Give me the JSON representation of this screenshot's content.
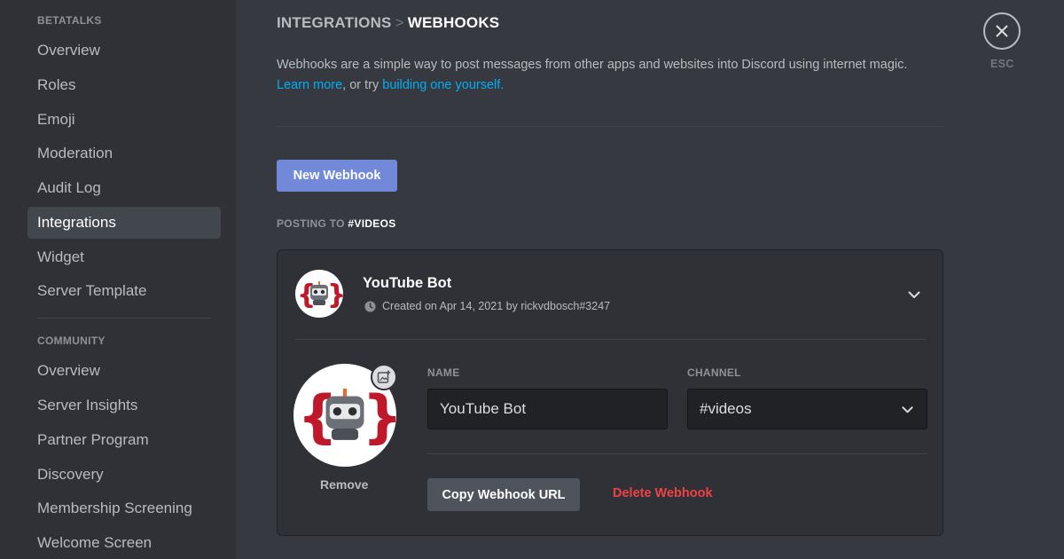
{
  "sidebar": {
    "server_header": "BETATALKS",
    "server_items": [
      {
        "label": "Overview"
      },
      {
        "label": "Roles"
      },
      {
        "label": "Emoji"
      },
      {
        "label": "Moderation"
      },
      {
        "label": "Audit Log"
      },
      {
        "label": "Integrations",
        "active": true
      },
      {
        "label": "Widget"
      },
      {
        "label": "Server Template"
      }
    ],
    "community_header": "COMMUNITY",
    "community_items": [
      {
        "label": "Overview"
      },
      {
        "label": "Server Insights"
      },
      {
        "label": "Partner Program"
      },
      {
        "label": "Discovery"
      },
      {
        "label": "Membership Screening"
      },
      {
        "label": "Welcome Screen"
      }
    ]
  },
  "breadcrumb": {
    "parent": "INTEGRATIONS",
    "separator": ">",
    "current": "WEBHOOKS"
  },
  "description": {
    "text": "Webhooks are a simple way to post messages from other apps and websites into Discord using internet magic.",
    "learn_more": "Learn more",
    "or_try": ", or try ",
    "build_link": "building one yourself."
  },
  "new_webhook_label": "New Webhook",
  "posting": {
    "prefix": "POSTING TO ",
    "channel": "#VIDEOS"
  },
  "webhook": {
    "name": "YouTube Bot",
    "created": "Created on Apr 14, 2021 by rickvdbosch#3247",
    "name_label": "NAME",
    "name_value": "YouTube Bot",
    "channel_label": "CHANNEL",
    "channel_value": "#videos",
    "remove_label": "Remove",
    "copy_url_label": "Copy Webhook URL",
    "delete_label": "Delete Webhook"
  },
  "close": {
    "label": "ESC"
  },
  "colors": {
    "accent": "#7289da",
    "danger": "#ed4245",
    "link": "#00aff4"
  },
  "icons": [
    "clock-icon",
    "chevron-down-icon",
    "upload-image-icon",
    "close-icon",
    "bot-avatar"
  ]
}
